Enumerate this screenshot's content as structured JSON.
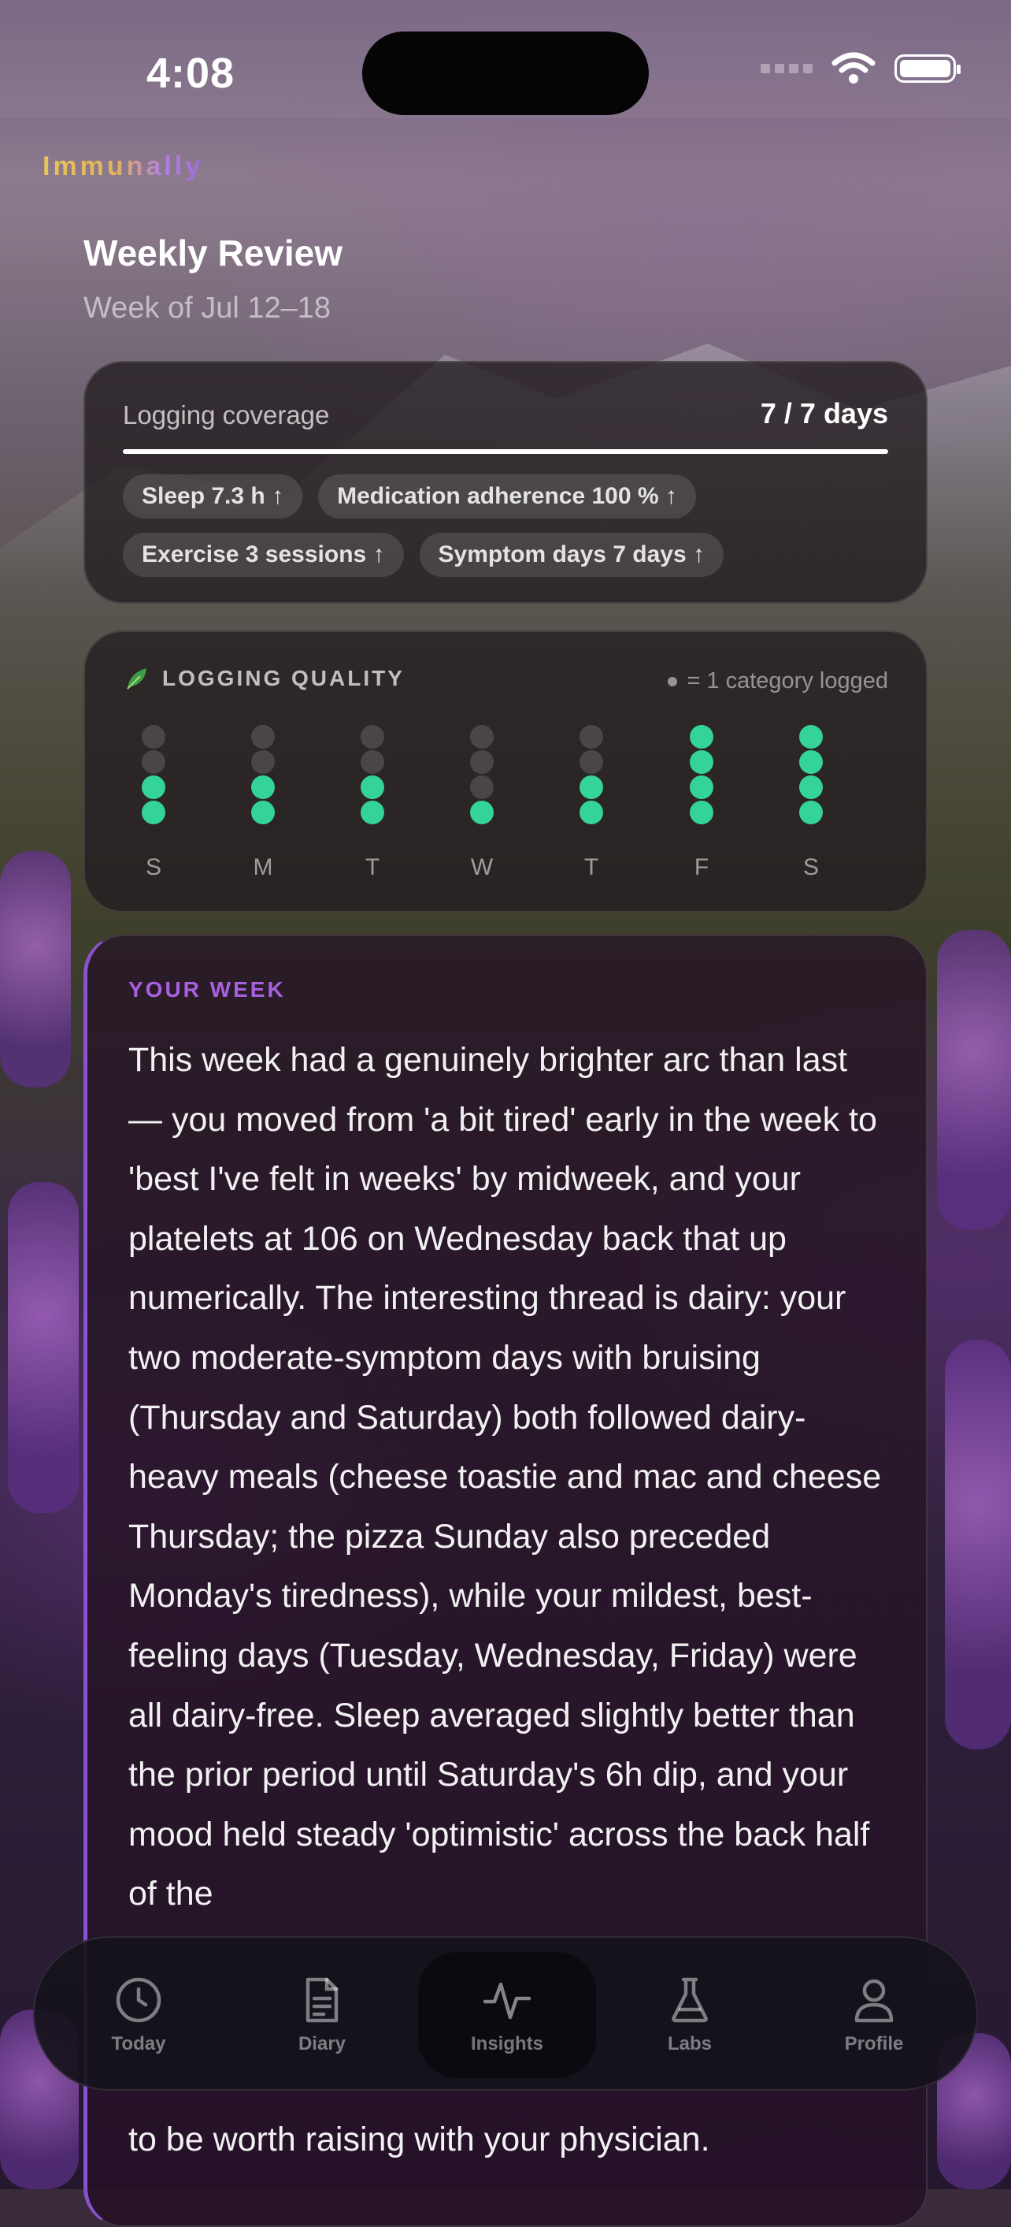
{
  "status": {
    "time": "4:08"
  },
  "brand": "Immunally",
  "header": {
    "title": "Weekly Review",
    "subtitle": "Week of Jul 12–18"
  },
  "coverage": {
    "label": "Logging coverage",
    "value": "7 / 7 days",
    "progress": 1.0,
    "metrics": [
      "Sleep 7.3 h ↑",
      "Medication adherence 100 % ↑",
      "Exercise 3 sessions ↑",
      "Symptom days 7 days ↑"
    ]
  },
  "quality": {
    "icon": "leaf-icon",
    "title": "LOGGING QUALITY",
    "legend": "= 1 category logged",
    "accent": "#34d399",
    "days": [
      {
        "label": "S",
        "logged": 2
      },
      {
        "label": "M",
        "logged": 2
      },
      {
        "label": "T",
        "logged": 2
      },
      {
        "label": "W",
        "logged": 1
      },
      {
        "label": "T",
        "logged": 2
      },
      {
        "label": "F",
        "logged": 4
      },
      {
        "label": "S",
        "logged": 4
      }
    ],
    "total_per_day": 4
  },
  "week": {
    "label": "YOUR WEEK",
    "text": "This week had a genuinely brighter arc than last — you moved from 'a bit tired' early in the week to 'best I've felt in weeks' by midweek, and your platelets at 106 on Wednesday back that up numerically. The interesting thread is dairy: your two moderate-symptom days with bruising (Thursday and Saturday) both followed dairy-heavy meals (cheese toastie and mac and cheese Thursday; the pizza Sunday also preceded Monday's tiredness), while your mildest, best-feeling days (Tuesday, Wednesday, Friday) were all dairy-free. Sleep averaged slightly better than the prior period until Saturday's 6h dip, and your mood held steady 'optimistic' across the back half of the",
    "tail": "to be worth raising with your physician.",
    "accent": "#a960e0"
  },
  "tabs": [
    {
      "label": "Today",
      "icon": "clock-icon"
    },
    {
      "label": "Diary",
      "icon": "document-icon"
    },
    {
      "label": "Insights",
      "icon": "pulse-icon",
      "active": true
    },
    {
      "label": "Labs",
      "icon": "flask-icon"
    },
    {
      "label": "Profile",
      "icon": "person-icon"
    }
  ]
}
